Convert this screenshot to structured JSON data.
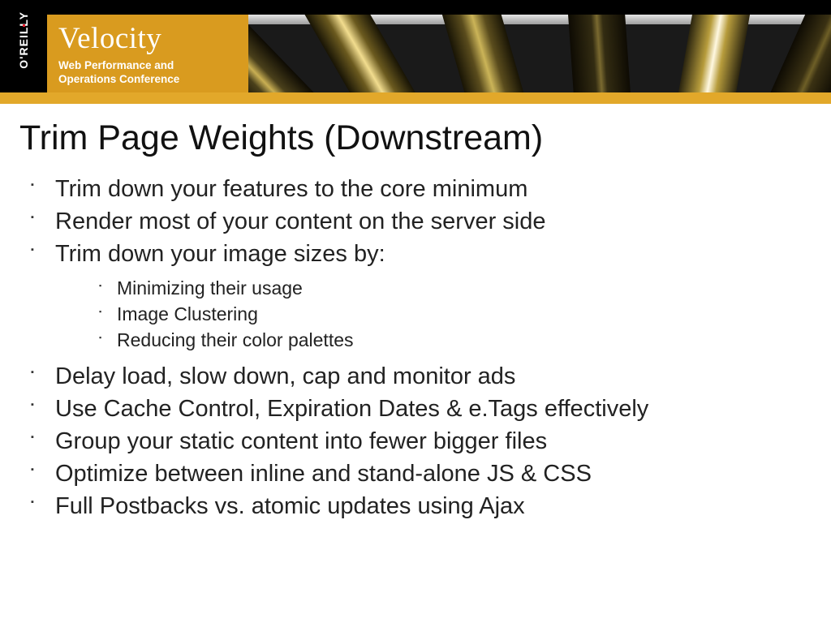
{
  "header": {
    "publisher": "O'REILLY",
    "brand": "Velocity",
    "tagline_line1": "Web Performance and",
    "tagline_line2": "Operations Conference"
  },
  "slide": {
    "title": "Trim Page Weights (Downstream)",
    "bullets_top": [
      "Trim down your features to the core minimum",
      "Render most of your content on the server side",
      "Trim down your image sizes by:"
    ],
    "sub_bullets": [
      "Minimizing their usage",
      "Image Clustering",
      "Reducing their color palettes"
    ],
    "bullets_bottom": [
      "Delay load, slow down, cap and monitor ads",
      "Use Cache Control, Expiration Dates & e.Tags effectively",
      "Group your static content into fewer bigger files",
      "Optimize between inline and stand-alone JS & CSS",
      "Full Postbacks vs. atomic updates using Ajax"
    ]
  }
}
